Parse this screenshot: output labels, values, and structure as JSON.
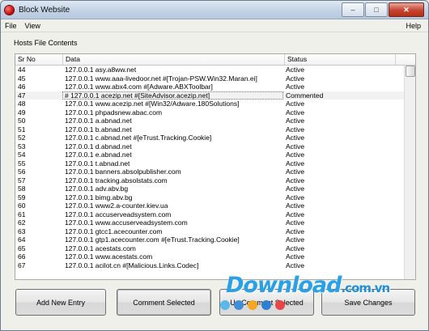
{
  "window": {
    "title": "Block Website",
    "controls": {
      "minimize": "–",
      "maximize": "□",
      "close": "✕"
    }
  },
  "menu": {
    "file": "File",
    "view": "View",
    "help": "Help"
  },
  "section_label": "Hosts File Contents",
  "table": {
    "headers": [
      "Sr No",
      "Data",
      "Status"
    ],
    "rows": [
      [
        "44",
        "127.0.0.1   asy.a8ww.net",
        "Active"
      ],
      [
        "45",
        "127.0.0.1   www.aaa-livedoor.net #[Trojan-PSW.Win32.Maran.ei]",
        "Active"
      ],
      [
        "46",
        "127.0.0.1   www.abx4.com #[Adware.ABXToolbar]",
        "Active"
      ],
      [
        "47",
        "# 127.0.0.1   acezip.net #[SiteAdvisor.acezip.net]",
        "Commented"
      ],
      [
        "48",
        "127.0.0.1   www.acezip.net #[Win32/Adware.180Solutions]",
        "Active"
      ],
      [
        "49",
        "127.0.0.1   phpadsnew.abac.com",
        "Active"
      ],
      [
        "50",
        "127.0.0.1   a.abnad.net",
        "Active"
      ],
      [
        "51",
        "127.0.0.1   b.abnad.net",
        "Active"
      ],
      [
        "52",
        "127.0.0.1   c.abnad.net #[eTrust.Tracking.Cookie]",
        "Active"
      ],
      [
        "53",
        "127.0.0.1   d.abnad.net",
        "Active"
      ],
      [
        "54",
        "127.0.0.1   e.abnad.net",
        "Active"
      ],
      [
        "55",
        "127.0.0.1   t.abnad.net",
        "Active"
      ],
      [
        "56",
        "127.0.0.1   banners.absolpublisher.com",
        "Active"
      ],
      [
        "57",
        "127.0.0.1   tracking.absolstats.com",
        "Active"
      ],
      [
        "58",
        "127.0.0.1   adv.abv.bg",
        "Active"
      ],
      [
        "59",
        "127.0.0.1   bimg.abv.bg",
        "Active"
      ],
      [
        "60",
        "127.0.0.1   www2.a-counter.kiev.ua",
        "Active"
      ],
      [
        "61",
        "127.0.0.1   accuserveadsystem.com",
        "Active"
      ],
      [
        "62",
        "127.0.0.1   www.accuserveadsystem.com",
        "Active"
      ],
      [
        "63",
        "127.0.0.1   gtcc1.acecounter.com",
        "Active"
      ],
      [
        "64",
        "127.0.0.1   gtp1.acecounter.com #[eTrust.Tracking.Cookie]",
        "Active"
      ],
      [
        "65",
        "127.0.0.1   acestats.com",
        "Active"
      ],
      [
        "66",
        "127.0.0.1   www.acestats.com",
        "Active"
      ],
      [
        "67",
        "127.0.0.1   acilot.cn #[Malicious.Links.Codec]",
        "Active"
      ]
    ],
    "selected_row_index": 3
  },
  "buttons": {
    "add": "Add New Entry",
    "comment": "Comment Selected",
    "uncomment": "Un Comment Selected",
    "save": "Save Changes"
  },
  "watermark": {
    "main": "Download",
    "suffix": ".com.vn"
  },
  "dot_colors": [
    "#5bb8ea",
    "#3f8fd8",
    "#f5a623",
    "#2f7fd0",
    "#e8464b"
  ]
}
